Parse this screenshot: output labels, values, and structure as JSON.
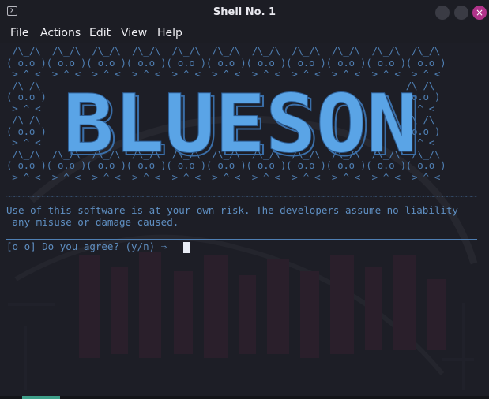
{
  "window": {
    "title": "Shell No. 1",
    "close_glyph": "×"
  },
  "menu": [
    "File",
    "Actions",
    "Edit",
    "View",
    "Help"
  ],
  "terminal": {
    "ascii_art": " /\\_/\\  /\\_/\\  /\\_/\\  /\\_/\\  /\\_/\\  /\\_/\\  /\\_/\\  /\\_/\\  /\\_/\\  /\\_/\\  /\\_/\\\n( o.o )( o.o )( o.o )( o.o )( o.o )( o.o )( o.o )( o.o )( o.o )( o.o )( o.o )\n > ^ <  > ^ <  > ^ <  > ^ <  > ^ <  > ^ <  > ^ <  > ^ <  > ^ <  > ^ <  > ^ <\n /\\_/\\                                                                /\\_/\\\n( o.o )                                                              ( o.o )\n > ^ <                                                                > ^ <\n /\\_/\\                                                                /\\_/\\\n( o.o )                                                              ( o.o )\n > ^ <                                                                > ^ <\n /\\_/\\  /\\_/\\  /\\_/\\  /\\_/\\  /\\_/\\  /\\_/\\  /\\_/\\  /\\_/\\  /\\_/\\  /\\_/\\  /\\_/\\\n( o.o )( o.o )( o.o )( o.o )( o.o )( o.o )( o.o )( o.o )( o.o )( o.o )( o.o )\n > ^ <  > ^ <  > ^ <  > ^ <  > ^ <  > ^ <  > ^ <  > ^ <  > ^ <  > ^ <  > ^ <",
    "logo_text": "BLUESON",
    "separator": "~~~~~~~~~~~~~~~~~~~~~~~~~~~~~~~~~~~~~~~~~~~~~~~~~~~~~~~~~~~~~~~~~~~~~~~~~~~~~~~~~~~~~~~~~~~~~~~~~~~~~~~~~~",
    "warning": "Use of this software is at your own risk. The developers assume no liability\n any misuse or damage caused.",
    "prompt": "[o_o] Do you agree? (y/n) ⇒ "
  },
  "colors": {
    "accent": "#4f7fb3",
    "logo": "#5aa4e6",
    "close_button": "#b0338a"
  }
}
